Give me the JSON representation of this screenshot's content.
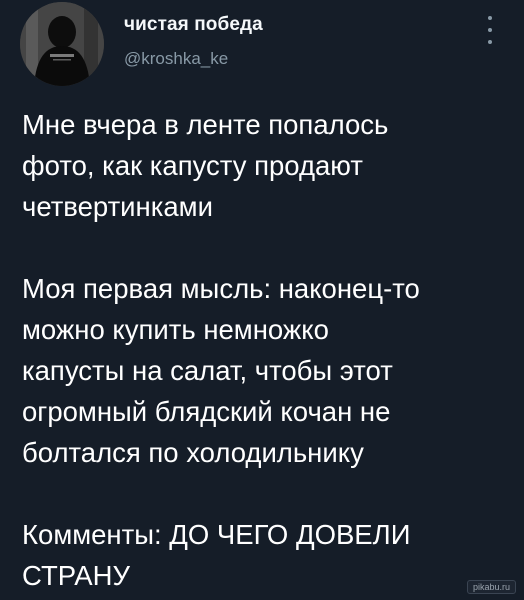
{
  "user": {
    "display_name": "чистая победа",
    "handle": "@kroshka_ke"
  },
  "menu": {
    "icon": "more-vertical-icon"
  },
  "tweet": {
    "paragraphs": [
      {
        "lines": [
          "Мне вчера в ленте попалось",
          "фото, как капусту продают",
          "четвертинками"
        ]
      },
      {
        "lines": [
          "Моя первая мысль: наконец-то",
          "можно купить немножко",
          "капусты на салат, чтобы этот",
          "огромный блядский кочан не",
          "болтался по холодильнику"
        ]
      },
      {
        "lines": [
          "Комменты: ДО ЧЕГО ДОВЕЛИ",
          "СТРАНУ"
        ]
      }
    ]
  },
  "watermark": "pikabu.ru",
  "colors": {
    "background": "#151d28",
    "text": "#ffffff",
    "secondary_text": "#8899a6"
  }
}
